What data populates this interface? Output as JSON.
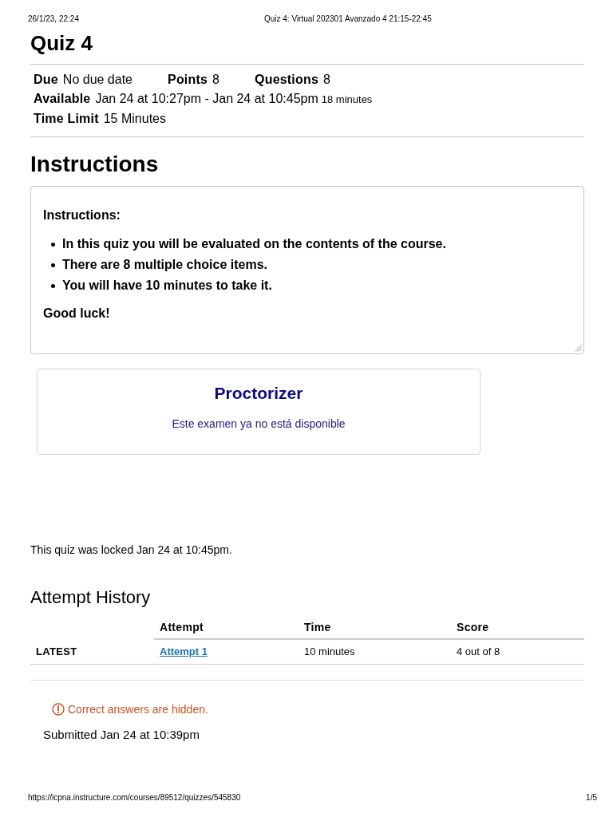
{
  "print_header": {
    "date": "26/1/23, 22:24",
    "title": "Quiz 4: Virtual 202301 Avanzado 4 21:15-22:45"
  },
  "quiz": {
    "title": "Quiz 4",
    "details": [
      [
        {
          "label": "Due",
          "value": "No due date"
        },
        {
          "label": "Points",
          "value": "8"
        },
        {
          "label": "Questions",
          "value": "8"
        }
      ],
      [
        {
          "label": "Available",
          "value": "Jan 24 at 10:27pm - Jan 24 at 10:45pm",
          "note": "18 minutes"
        }
      ],
      [
        {
          "label": "Time Limit",
          "value": "15 Minutes"
        }
      ]
    ]
  },
  "instructions": {
    "heading": "Instructions",
    "title": "Instructions:",
    "items": [
      "In this quiz you will be evaluated on the contents of the course.",
      "There are 8 multiple choice items.",
      "You will have 10 minutes to take it."
    ],
    "closing": "Good luck!"
  },
  "proctorizer": {
    "title": "Proctorizer",
    "message": "Este examen ya no está disponible"
  },
  "lock_notice": "This quiz was locked Jan 24 at 10:45pm.",
  "attempt_history": {
    "heading": "Attempt History",
    "columns": [
      "Attempt",
      "Time",
      "Score"
    ],
    "rows": [
      {
        "label": "LATEST",
        "attempt": "Attempt 1",
        "time": "10 minutes",
        "score": "4 out of 8"
      }
    ]
  },
  "result": {
    "warning": "Correct answers are hidden.",
    "submitted": "Submitted Jan 24 at 10:39pm"
  },
  "print_footer": {
    "url": "https://icpna.instructure.com/courses/89512/quizzes/545830",
    "page": "1/5"
  }
}
